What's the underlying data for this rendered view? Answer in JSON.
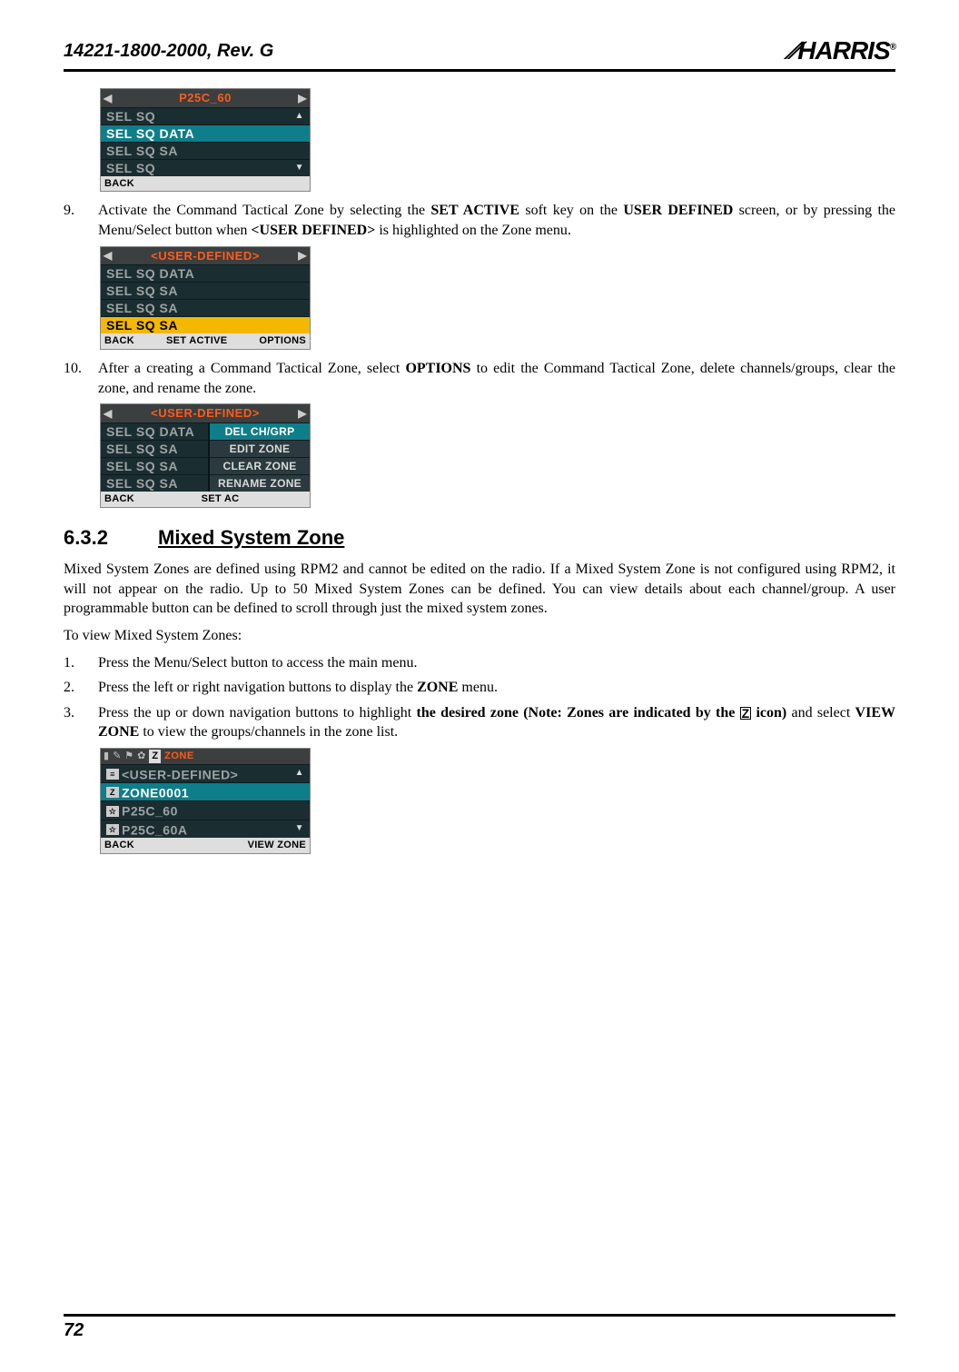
{
  "header": {
    "doc_id": "14221-1800-2000, Rev. G",
    "logo_text": "HARRIS",
    "logo_reg": "®"
  },
  "screens": {
    "s1": {
      "title": "P25C_60",
      "rows": [
        "SEL SQ",
        "SEL SQ DATA",
        "SEL SQ SA",
        "SEL SQ"
      ],
      "selected_index": 1,
      "foot_left": "BACK",
      "foot_center": "",
      "foot_right": ""
    },
    "s2": {
      "title": "<USER-DEFINED>",
      "rows": [
        "SEL SQ DATA",
        "SEL SQ SA",
        "SEL SQ SA",
        "SEL SQ SA"
      ],
      "selected_index": 3,
      "foot_left": "BACK",
      "foot_center": "SET ACTIVE",
      "foot_right": "OPTIONS"
    },
    "s3": {
      "title": "<USER-DEFINED>",
      "rows": [
        "SEL SQ DATA",
        "SEL SQ SA",
        "SEL SQ SA",
        "SEL SQ SA"
      ],
      "foot_left": "BACK",
      "foot_center": "SET AC",
      "popup": [
        "DEL CH/GRP",
        "EDIT ZONE",
        "CLEAR ZONE",
        "RENAME ZONE"
      ],
      "popup_selected_index": 0
    },
    "s4": {
      "title": "ZONE",
      "icon_box": "Z",
      "rows": [
        {
          "icon": "≡",
          "label": "<USER-DEFINED>"
        },
        {
          "icon": "Z",
          "label": "ZONE0001"
        },
        {
          "icon": "☆",
          "label": "P25C_60"
        },
        {
          "icon": "☆",
          "label": "P25C_60A"
        }
      ],
      "selected_index": 1,
      "foot_left": "BACK",
      "foot_center": "",
      "foot_right": "VIEW ZONE"
    }
  },
  "steps": {
    "step9_num": "9.",
    "step9_a": "Activate the Command Tactical Zone by selecting the ",
    "step9_b": "SET ACTIVE",
    "step9_c": " soft key on the ",
    "step9_d": "USER DEFINED",
    "step9_e": " screen, or by pressing the Menu/Select button when ",
    "step9_f": "<USER DEFINED>",
    "step9_g": " is highlighted on the Zone menu.",
    "step10_num": "10.",
    "step10_a": "After a creating a Command Tactical Zone, select ",
    "step10_b": "OPTIONS",
    "step10_c": " to edit the Command Tactical Zone, delete channels/groups, clear the zone, and rename the zone."
  },
  "section": {
    "num": "6.3.2",
    "title": "Mixed System Zone"
  },
  "paras": {
    "p1": "Mixed System Zones are defined using RPM2 and cannot be edited on the radio. If a Mixed System Zone is not configured using RPM2, it will not appear on the radio. Up to 50 Mixed System Zones can be defined. You can view details about each channel/group. A user programmable button can be defined to scroll through just the mixed system zones.",
    "p2": "To view Mixed System Zones:"
  },
  "sublist": {
    "i1_num": "1.",
    "i1": "Press the Menu/Select button to access the main menu.",
    "i2_num": "2.",
    "i2_a": "Press the left or right navigation buttons to display the ",
    "i2_b": "ZONE",
    "i2_c": " menu.",
    "i3_num": "3.",
    "i3_a": "Press the up or down navigation buttons to highlight ",
    "i3_b": "the desired zone (Note: Zones are indicated by the ",
    "i3_icon": "Z",
    "i3_c": " icon)",
    "i3_d": " and select ",
    "i3_e": "VIEW ZONE",
    "i3_f": " to view the groups/channels in the zone list."
  },
  "footer": {
    "page": "72"
  }
}
